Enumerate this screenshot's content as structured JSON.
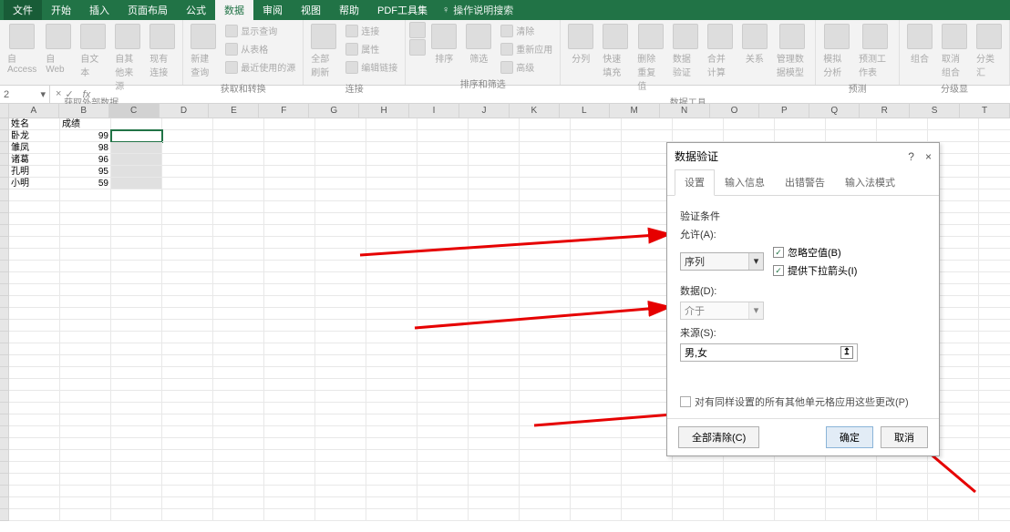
{
  "menu": {
    "file": "文件",
    "tabs": [
      "开始",
      "插入",
      "页面布局",
      "公式",
      "数据",
      "审阅",
      "视图",
      "帮助",
      "PDF工具集"
    ],
    "active_index": 4,
    "tell_me": "操作说明搜索"
  },
  "ribbon": {
    "groups": [
      {
        "label": "获取外部数据",
        "buttons": [
          {
            "label": "自 Access",
            "size": "big"
          },
          {
            "label": "自 Web",
            "size": "big"
          },
          {
            "label": "自文本",
            "size": "big"
          },
          {
            "label": "自其他来源",
            "size": "big"
          },
          {
            "label": "现有连接",
            "size": "big"
          }
        ]
      },
      {
        "label": "获取和转换",
        "buttons": [
          {
            "label": "新建查询",
            "size": "big"
          }
        ],
        "side_items": [
          "显示查询",
          "从表格",
          "最近使用的源"
        ]
      },
      {
        "label": "连接",
        "buttons": [
          {
            "label": "全部刷新",
            "size": "big"
          }
        ],
        "side_items": [
          "连接",
          "属性",
          "编辑链接"
        ]
      },
      {
        "label": "排序和筛选",
        "buttons": [
          {
            "label": "排序",
            "size": "big"
          },
          {
            "label": "筛选",
            "size": "big"
          }
        ],
        "side_items": [
          "清除",
          "重新应用",
          "高级"
        ],
        "pre_icons": [
          "az",
          "za"
        ]
      },
      {
        "label": "数据工具",
        "buttons": [
          {
            "label": "分列",
            "size": "big"
          },
          {
            "label": "快速填充",
            "size": "big"
          },
          {
            "label": "删除重复值",
            "size": "big"
          },
          {
            "label": "数据验证",
            "size": "big"
          },
          {
            "label": "合并计算",
            "size": "big"
          },
          {
            "label": "关系",
            "size": "big"
          },
          {
            "label": "管理数据模型",
            "size": "big"
          }
        ]
      },
      {
        "label": "预测",
        "buttons": [
          {
            "label": "模拟分析",
            "size": "big"
          },
          {
            "label": "预测工作表",
            "size": "big"
          }
        ]
      },
      {
        "label": "分级显",
        "buttons": [
          {
            "label": "组合",
            "size": "big"
          },
          {
            "label": "取消组合",
            "size": "big"
          },
          {
            "label": "分类汇",
            "size": "big"
          }
        ]
      }
    ]
  },
  "name_box": {
    "value": "2"
  },
  "fx_label": "fx",
  "columns": [
    "A",
    "B",
    "C",
    "D",
    "E",
    "F",
    "G",
    "H",
    "I",
    "J",
    "K",
    "L",
    "M",
    "N",
    "O",
    "P",
    "Q",
    "R",
    "S",
    "T"
  ],
  "sheet": {
    "header": [
      "姓名",
      "成绩"
    ],
    "rows": [
      {
        "name": "卧龙",
        "score": "99"
      },
      {
        "name": "雏凤",
        "score": "98"
      },
      {
        "name": "诸葛",
        "score": "96"
      },
      {
        "name": "孔明",
        "score": "95"
      },
      {
        "name": "小明",
        "score": "59"
      }
    ]
  },
  "dialog": {
    "title": "数据验证",
    "help": "?",
    "close": "×",
    "tabs": [
      "设置",
      "输入信息",
      "出错警告",
      "输入法模式"
    ],
    "active_tab": 0,
    "section_label": "验证条件",
    "allow_label": "允许(A):",
    "allow_value": "序列",
    "ignore_blank": "忽略空值(B)",
    "provide_dropdown": "提供下拉箭头(I)",
    "data_label": "数据(D):",
    "data_value": "介于",
    "source_label": "来源(S):",
    "source_value": "男,女",
    "apply_all": "对有同样设置的所有其他单元格应用这些更改(P)",
    "clear_all": "全部清除(C)",
    "ok": "确定",
    "cancel": "取消"
  }
}
